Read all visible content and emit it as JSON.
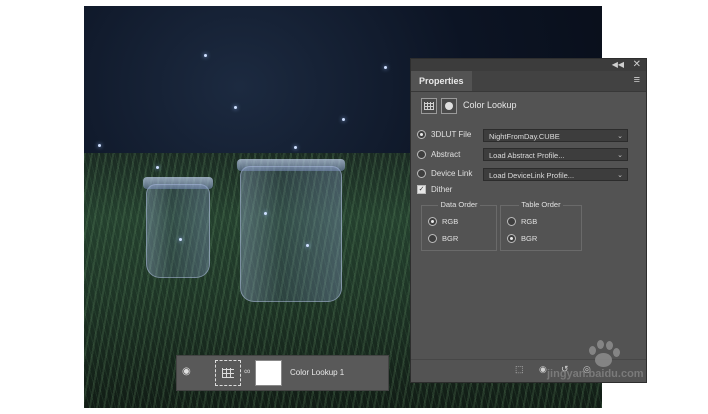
{
  "panel": {
    "tab_label": "Properties",
    "title": "Color Lookup",
    "options": [
      {
        "label": "3DLUT File",
        "selected": true,
        "value": "NightFromDay.CUBE"
      },
      {
        "label": "Abstract",
        "selected": false,
        "value": "Load Abstract Profile..."
      },
      {
        "label": "Device Link",
        "selected": false,
        "value": "Load DeviceLink Profile..."
      }
    ],
    "dither_label": "Dither",
    "dither_checked": true,
    "data_order": {
      "title": "Data Order",
      "rgb": "RGB",
      "bgr": "BGR",
      "selected": "RGB"
    },
    "table_order": {
      "title": "Table Order",
      "rgb": "RGB",
      "bgr": "BGR",
      "selected": "BGR"
    }
  },
  "layer": {
    "name": "Color Lookup 1"
  },
  "watermark": {
    "text": "jingyan.baidu.com"
  },
  "colors": {
    "panel_bg": "#535353",
    "panel_dark": "#3c3c3c",
    "field_bg": "#3d3d3d",
    "text": "#e0e0e0"
  },
  "icons": [
    "adjustment-grid-icon",
    "mask-icon",
    "menu-icon",
    "eye-icon",
    "link-icon",
    "radio-icon",
    "checkbox-icon",
    "chevron-down-icon"
  ]
}
